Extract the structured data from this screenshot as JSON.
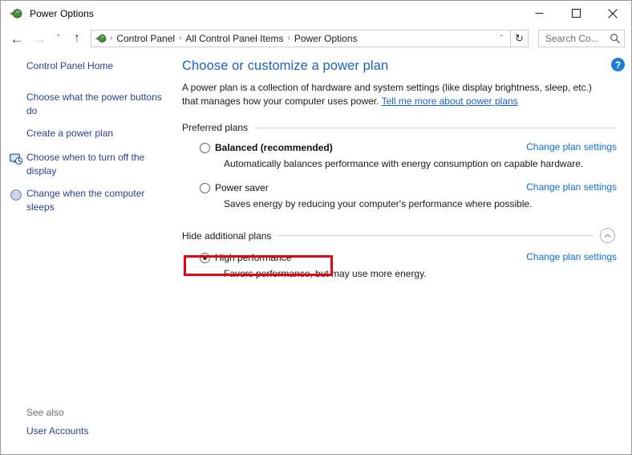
{
  "window": {
    "title": "Power Options",
    "icon": "power-plug-battery-icon",
    "controls": {
      "minimize": "minimize-icon",
      "maximize": "maximize-icon",
      "close": "close-icon"
    }
  },
  "nav": {
    "back": "←",
    "forward": "→",
    "history": "ˇ",
    "up": "↑",
    "refresh": "↻",
    "dropdown": "ˇ",
    "breadcrumbs": [
      "Control Panel",
      "All Control Panel Items",
      "Power Options"
    ],
    "separator": "›"
  },
  "search": {
    "placeholder": "Search Co...",
    "icon": "search-icon"
  },
  "sidebar": {
    "items": [
      {
        "label": "Control Panel Home",
        "icon": null
      },
      {
        "label": "Choose what the power buttons do",
        "icon": null
      },
      {
        "label": "Create a power plan",
        "icon": null
      },
      {
        "label": "Choose when to turn off the display",
        "icon": "display-clock-icon"
      },
      {
        "label": "Change when the computer sleeps",
        "icon": "sleep-moon-icon"
      }
    ],
    "see_also_label": "See also",
    "see_also_link": "User Accounts"
  },
  "main": {
    "heading": "Choose or customize a power plan",
    "intro_part1": "A power plan is a collection of hardware and system settings (like display brightness, sleep, etc.) that manages how your computer uses power. ",
    "intro_link": "Tell me more about power plans",
    "preferred_section_label": "Preferred plans",
    "additional_section_label": "Hide additional plans",
    "collapse_icon": "chevron-up-icon",
    "change_link_label": "Change plan settings",
    "plans": [
      {
        "name": "Balanced (recommended)",
        "description": "Automatically balances performance with energy consumption on capable hardware.",
        "selected": false,
        "bold": true,
        "change_label": "Change plan settings"
      },
      {
        "name": "Power saver",
        "description": "Saves energy by reducing your computer's performance where possible.",
        "selected": false,
        "bold": false,
        "change_label": "Change plan settings"
      }
    ],
    "additional_plans": [
      {
        "name": "High performance",
        "description": "Favors performance, but may use more energy.",
        "selected": true,
        "bold": false,
        "highlighted": true,
        "change_label": "Change plan settings"
      }
    ]
  },
  "help": {
    "label": "?"
  },
  "colors": {
    "heading_blue": "#1b61c4",
    "link_blue": "#0e6fd4",
    "sidebar_link": "#2a3f8f",
    "annotation_red": "#e30613",
    "help_blue": "#1b7fd4"
  }
}
